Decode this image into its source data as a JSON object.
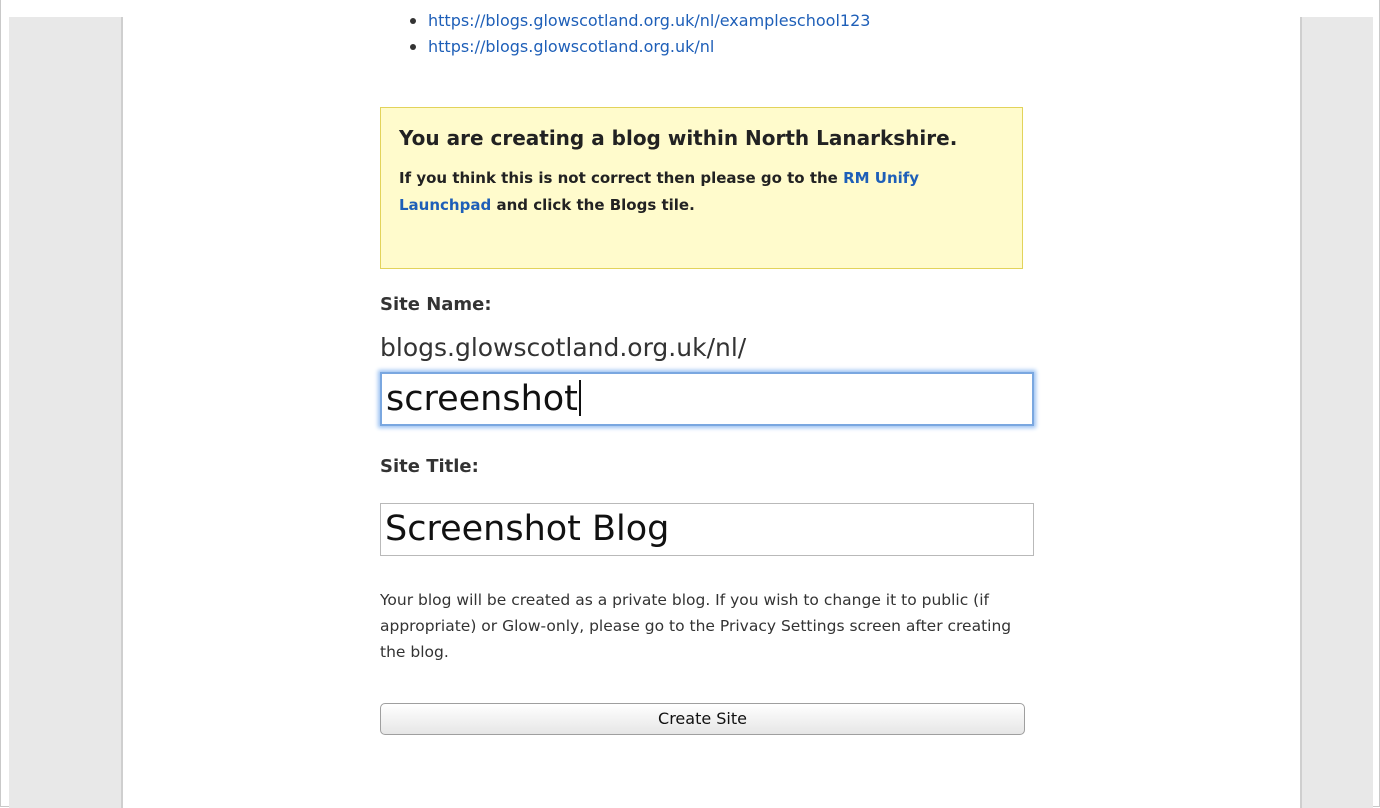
{
  "url_list": [
    "https://blogs.glowscotland.org.uk/nl/exampleschool123",
    "https://blogs.glowscotland.org.uk/nl"
  ],
  "notice": {
    "title": "You are creating a blog within North Lanarkshire.",
    "text_before": "If you think this is not correct then please go to the ",
    "link": "RM Unify Launchpad",
    "text_after": " and click the Blogs tile."
  },
  "form": {
    "site_name_label": "Site Name:",
    "site_name_prefix": "blogs.glowscotland.org.uk/nl/",
    "site_name_value": "screenshot",
    "site_title_label": "Site Title:",
    "site_title_value": "Screenshot Blog",
    "info_text": "Your blog will be created as a private blog. If you wish to change it to public (if appropriate) or Glow-only, please go to the Privacy Settings screen after creating the blog.",
    "create_button": "Create Site"
  },
  "colors": {
    "link": "#1e5fb8",
    "notice_background": "#fffbcc",
    "notice_border": "#e2d35b",
    "focus_ring": "#7aa7e0"
  }
}
